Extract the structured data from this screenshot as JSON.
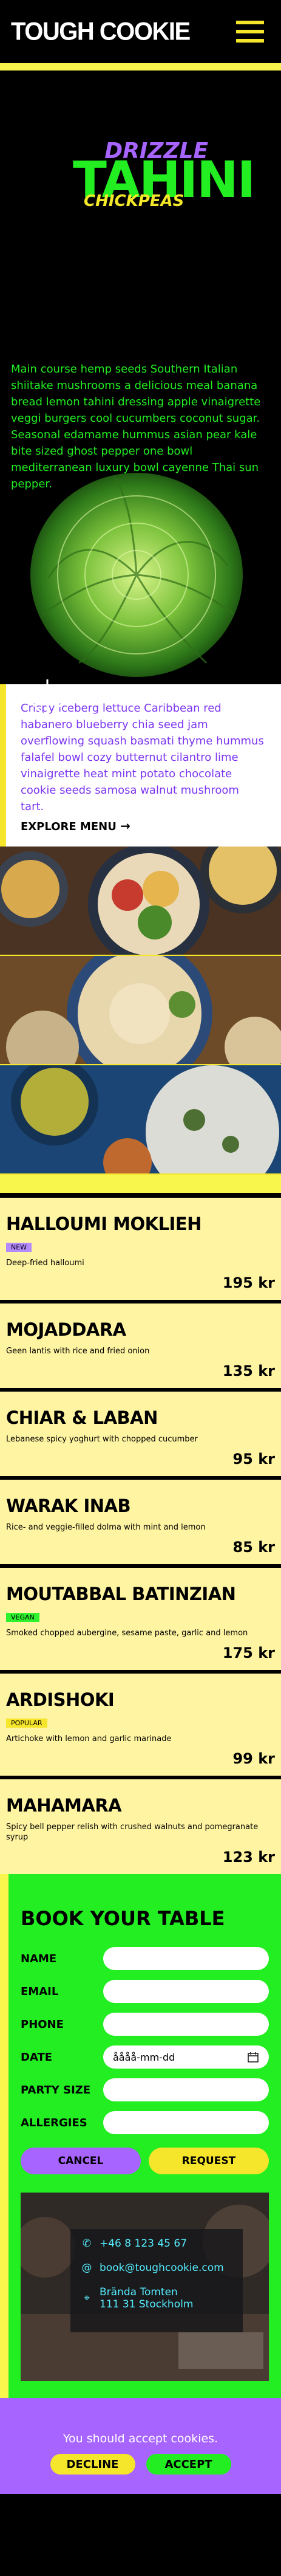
{
  "header": {
    "logo": "TOUGH COOKIE"
  },
  "hero": {
    "title_top": "DRIZZLE",
    "title_main": "TAHINI",
    "title_sub": "CHICKPEAS",
    "text": "Main course hemp seeds Southern Italian shiitake mushrooms a delicious meal banana bread lemon tahini dressing apple vinaigrette veggi burgers cool cucumbers coconut sugar. Seasonal edamame hummus asian pear kale bite sized ghost pepper one bowl mediterranean luxury bowl cayenne Thai sun pepper."
  },
  "intro": {
    "text": "Crispy iceberg lettuce Caribbean red habanero blueberry chia seed jam overflowing squash basmati thyme hummus falafel bowl cozy butternut cilantro lime vinaigrette heat mint potato chocolate cookie seeds samosa walnut mushroom tart.",
    "link": "EXPLORE MENU",
    "link_arrow": "→"
  },
  "menu": [
    {
      "name": "HALLOUMI MOKLIEH",
      "badge": "NEW",
      "badge_type": "new",
      "desc": "Deep-fried halloumi",
      "price": "195 kr"
    },
    {
      "name": "MOJADDARA",
      "badge": "",
      "badge_type": "",
      "desc": "Geen lantis with rice and fried onion",
      "price": "135 kr"
    },
    {
      "name": "CHIAR & LABAN",
      "badge": "",
      "badge_type": "",
      "desc": "Lebanese spicy yoghurt with chopped cucumber",
      "price": "95 kr"
    },
    {
      "name": "WARAK INAB",
      "badge": "",
      "badge_type": "",
      "desc": "Rice- and veggie-filled dolma with mint and lemon",
      "price": "85 kr"
    },
    {
      "name": "MOUTABBAL BATINZIAN",
      "badge": "VEGAN",
      "badge_type": "vegan",
      "desc": "Smoked chopped aubergine, sesame paste, garlic and lemon",
      "price": "175 kr"
    },
    {
      "name": "ARDISHOKI",
      "badge": "POPULAR",
      "badge_type": "pop",
      "desc": "Artichoke with lemon and garlic marinade",
      "price": "99 kr"
    },
    {
      "name": "MAHAMARA",
      "badge": "",
      "badge_type": "",
      "desc": "Spicy bell pepper relish with crushed walnuts and pomegranate syrup",
      "price": "123 kr"
    }
  ],
  "booking": {
    "title": "BOOK YOUR TABLE",
    "fields": {
      "name": "NAME",
      "email": "EMAIL",
      "phone": "PHONE",
      "date": "DATE",
      "date_value": "åååå-mm-dd",
      "party": "PARTY SIZE",
      "allergies": "ALLERGIES"
    },
    "cancel": "CANCEL",
    "request": "REQUEST",
    "contact": {
      "phone": "+46 8 123 45 67",
      "email": "book@toughcookie.com",
      "addr1": "Brända Tomten",
      "addr2": "111 31 Stockholm"
    }
  },
  "cookie": {
    "text": "You should accept cookies.",
    "decline": "DECLINE",
    "accept": "ACCEPT"
  },
  "colors": {
    "yellow": "#f5e52b",
    "green": "#22ee22",
    "purple": "#a864ff",
    "cream": "#fff4a1"
  },
  "icons": [
    "menu-icon",
    "arrow-down-icon",
    "calendar-icon",
    "phone-icon",
    "at-icon",
    "location-icon"
  ]
}
